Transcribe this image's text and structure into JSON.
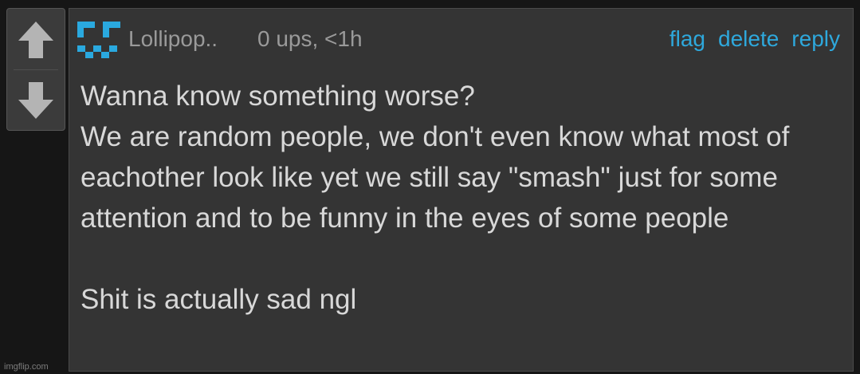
{
  "vote": {
    "up_icon": "arrow-up-icon",
    "down_icon": "arrow-down-icon"
  },
  "comment": {
    "avatar_icon": "pixel-face-avatar",
    "username": "Lollipop..",
    "meta": "0 ups, <1h",
    "actions": [
      {
        "label": "flag"
      },
      {
        "label": "delete"
      },
      {
        "label": "reply"
      }
    ],
    "text": "Wanna know something worse?\nWe are random people, we don't even know what most of eachother look like yet we still say \"smash\" just for some attention and to be funny in the eyes of some people\n\nShit is actually sad ngl"
  },
  "colors": {
    "accent": "#2ea8dc",
    "background": "#161616",
    "panel": "#343434",
    "text": "#d8d8d8",
    "muted": "#9a9a9a"
  },
  "watermark": "imgflip.com"
}
